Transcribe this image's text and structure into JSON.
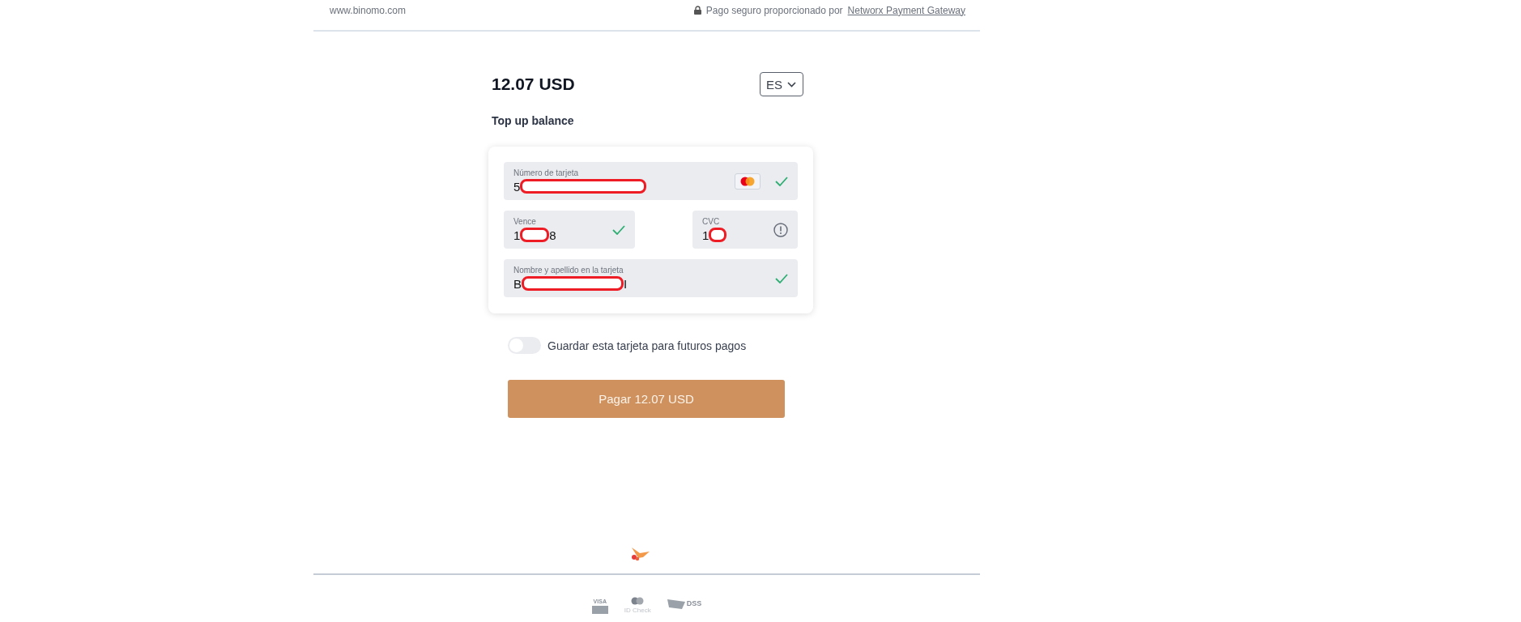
{
  "header": {
    "site": "www.binomo.com",
    "secure_text": "Pago seguro proporcionado por",
    "provider_link": "Networx Payment Gateway"
  },
  "amount": "12.07 USD",
  "language": {
    "label": "ES"
  },
  "description": "Top up balance",
  "fields": [
    {
      "label": "Número de tarjeta",
      "value_before": "5",
      "valid": true,
      "kind": "card",
      "redacted": true
    },
    {
      "label": "Vence",
      "value_before": "1",
      "value_after": "8",
      "valid": true,
      "kind": "half",
      "redacted": true
    },
    {
      "label": "CVC",
      "value_before": "1",
      "valid": false,
      "kind": "half",
      "redacted": true
    },
    {
      "label": "Nombre y apellido en la tarjeta",
      "value_before": "B",
      "value_after": "I",
      "valid": true,
      "kind": "full",
      "redacted": true
    }
  ],
  "save_card": {
    "label": "Guardar esta tarjeta para futuros pagos",
    "on": false
  },
  "pay_button": "Pagar 12.07 USD",
  "footer_badges": [
    {
      "kind": "visa",
      "text": "VISA"
    },
    {
      "kind": "idcheck",
      "text": "ID Check"
    },
    {
      "kind": "pci",
      "text": "DSS"
    }
  ]
}
